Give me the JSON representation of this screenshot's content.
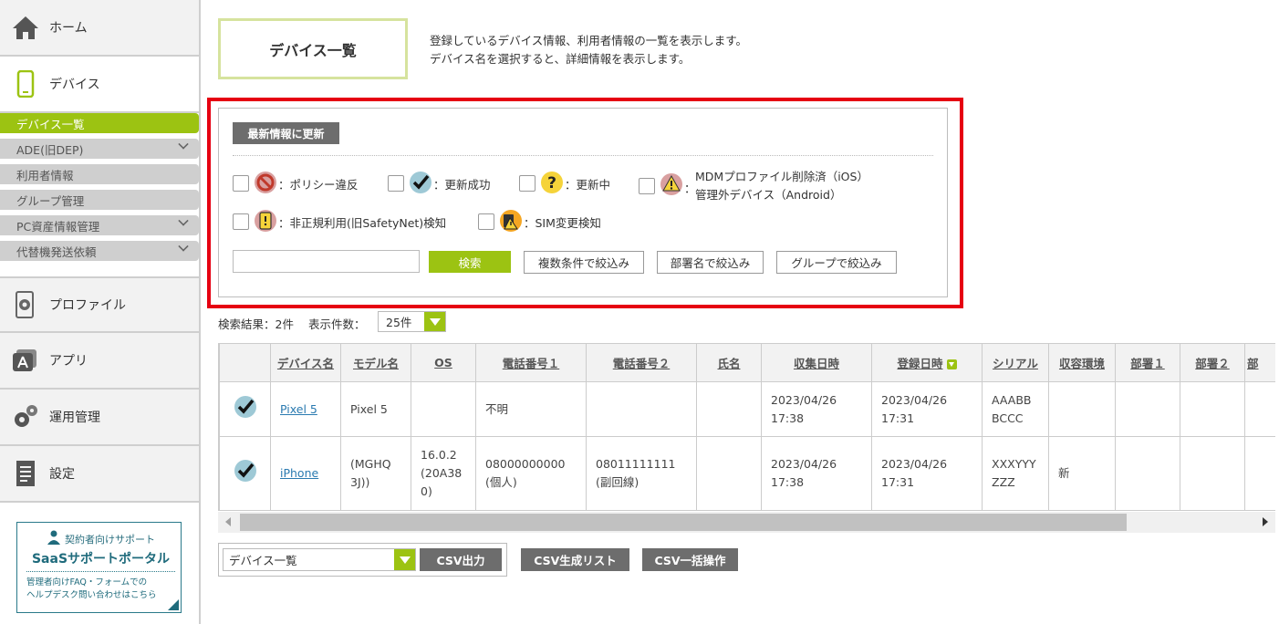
{
  "sidebar": {
    "home": "ホーム",
    "device": "デバイス",
    "sub_items": [
      {
        "label": "デバイス一覧",
        "active": true,
        "expandable": false
      },
      {
        "label": "ADE(旧DEP)",
        "active": false,
        "expandable": true
      },
      {
        "label": "利用者情報",
        "active": false,
        "expandable": false
      },
      {
        "label": "グループ管理",
        "active": false,
        "expandable": false
      },
      {
        "label": "PC資産情報管理",
        "active": false,
        "expandable": true
      },
      {
        "label": "代替機発送依頼",
        "active": false,
        "expandable": true
      }
    ],
    "profile": "プロファイル",
    "app": "アプリ",
    "ops": "運用管理",
    "settings": "設定",
    "portal": {
      "line1": "契約者向けサポート",
      "line2": "SaaSサポートポータル",
      "line3": "管理者向けFAQ・フォームでの",
      "line4": "ヘルプデスク問い合わせはこちら"
    }
  },
  "page": {
    "title": "デバイス一覧",
    "desc1": "登録しているデバイス情報、利用者情報の一覧を表示します。",
    "desc2": "デバイス名を選択すると、詳細情報を表示します。"
  },
  "filters": {
    "refresh": "最新情報に更新",
    "policy": "：ポリシー違反",
    "update_ok": "：更新成功",
    "updating": "：更新中",
    "mdm_line1": "MDMプロファイル削除済（iOS）",
    "mdm_line2": "管理外デバイス（Android）",
    "mdm_prefix": "：",
    "unauthorized": "：非正規利用(旧SafetyNet)検知",
    "sim": "：SIM変更検知",
    "search_value": "",
    "search_btn": "検索",
    "multi_btn": "複数条件で絞込み",
    "dept_btn": "部署名で絞込み",
    "group_btn": "グループで絞込み"
  },
  "results": {
    "count_text": "検索結果：2件",
    "per_page_label": "表示件数：",
    "per_page_value": "25件"
  },
  "table": {
    "headers": [
      "デバイス名",
      "モデル名",
      "OS",
      "電話番号１",
      "電話番号２",
      "氏名",
      "収集日時",
      "登録日時",
      "シリアル",
      "収容環境",
      "部署１",
      "部署２",
      "部"
    ],
    "rows": [
      {
        "device": "Pixel 5",
        "model": "Pixel 5",
        "os": "",
        "tel1": "不明",
        "tel1b": "",
        "tel2": "",
        "tel2b": "",
        "name": "",
        "collected1": "2023/04/26",
        "collected2": "17:38",
        "registered1": "2023/04/26",
        "registered2": "17:31",
        "serial1": "AAABB",
        "serial2": "BCCC",
        "env": "",
        "dept1": "",
        "dept2": ""
      },
      {
        "device": "iPhone",
        "model1": "(MGHQ",
        "model2": "3J))",
        "os1": "16.0.2",
        "os2": "(20A38",
        "os3": "0)",
        "tel1": "08000000000",
        "tel1b": "(個人)",
        "tel2": "08011111111",
        "tel2b": "(副回線)",
        "name": "",
        "collected1": "2023/04/26",
        "collected2": "17:38",
        "registered1": "2023/04/26",
        "registered2": "17:31",
        "serial1": "XXXYYY",
        "serial2": "ZZZ",
        "env": "新",
        "dept1": "",
        "dept2": ""
      }
    ]
  },
  "csv": {
    "select_value": "デバイス一覧",
    "output": "CSV出力",
    "gen_list": "CSV生成リスト",
    "bulk": "CSV一括操作"
  },
  "colors": {
    "accent": "#9cc312",
    "highlight_frame": "#e60012",
    "dark_button": "#6d6d6d",
    "link": "#2a7ab0"
  }
}
